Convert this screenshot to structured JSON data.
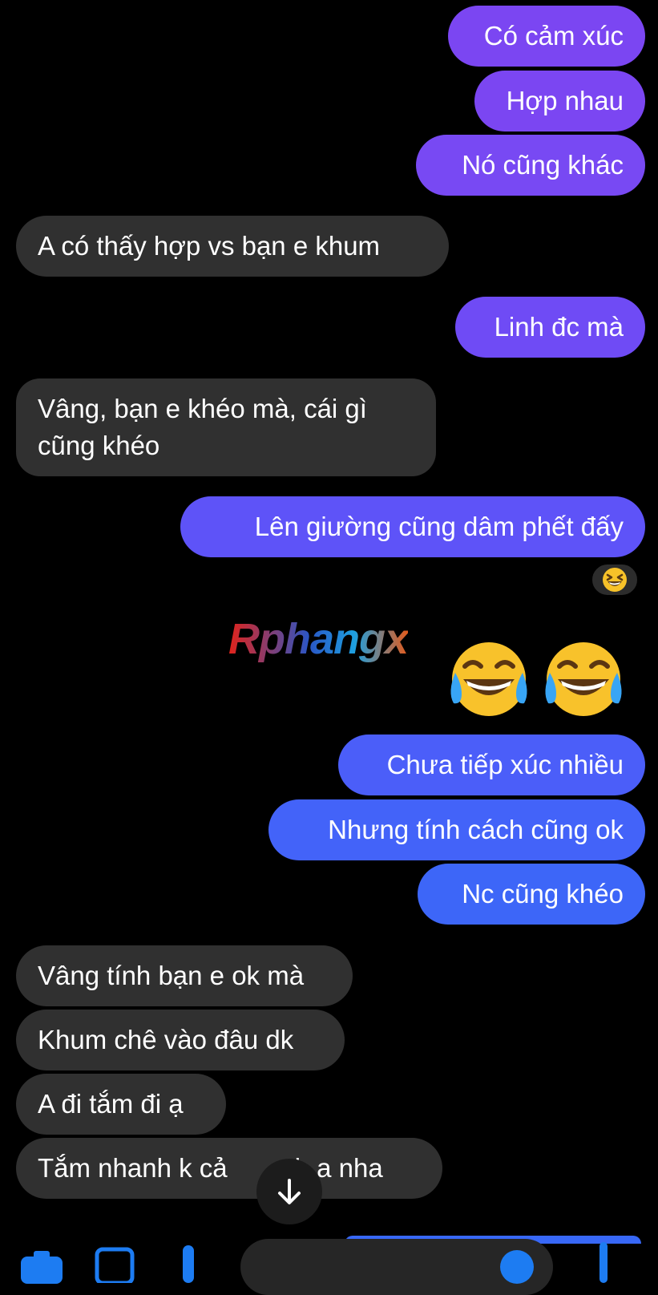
{
  "messages": [
    {
      "text": "Có cảm xúc",
      "dir": "out",
      "color": "#7b46f2"
    },
    {
      "text": "Hợp nhau",
      "dir": "out",
      "color": "#7b46f2"
    },
    {
      "text": "Nó cũng khác",
      "dir": "out",
      "color": "#7b46f2"
    },
    {
      "text": "A có thấy hợp vs bạn e khum",
      "dir": "in"
    },
    {
      "text": "Linh đc mà",
      "dir": "out",
      "color": "#6f4bf5"
    },
    {
      "text": "Vâng, bạn e khéo mà, cái gì cũng khéo",
      "dir": "in"
    },
    {
      "text": "Lên giường cũng dâm phết đấy",
      "dir": "out",
      "color": "#5e53f8"
    },
    {
      "text": "Chưa tiếp xúc nhiều",
      "dir": "out",
      "color": "#4b5ef9"
    },
    {
      "text": "Nhưng tính cách cũng ok",
      "dir": "out",
      "color": "#4363f9"
    },
    {
      "text": "Nc cũng khéo",
      "dir": "out",
      "color": "#3d66f8"
    },
    {
      "text": "Vâng tính bạn e ok mà",
      "dir": "in"
    },
    {
      "text": "Khum chê vào đâu dk",
      "dir": "in"
    },
    {
      "text": "A đi tắm đi ạ",
      "dir": "in"
    },
    {
      "text": "Tắm nhanh k cả",
      "text_after": "h a nha",
      "dir": "in"
    }
  ],
  "reaction": {
    "icon": "grinning-squinting-face-icon"
  },
  "emoji_message": {
    "icons": [
      "face-with-tears-of-joy-icon",
      "face-with-tears-of-joy-icon"
    ]
  },
  "watermark": {
    "text": "Rphangx"
  },
  "scroll_down": {
    "icon": "arrow-down-icon"
  },
  "composer": {
    "icons": [
      "camera-icon",
      "image-icon",
      "microphone-icon",
      "emoji-icon",
      "like-icon"
    ]
  }
}
